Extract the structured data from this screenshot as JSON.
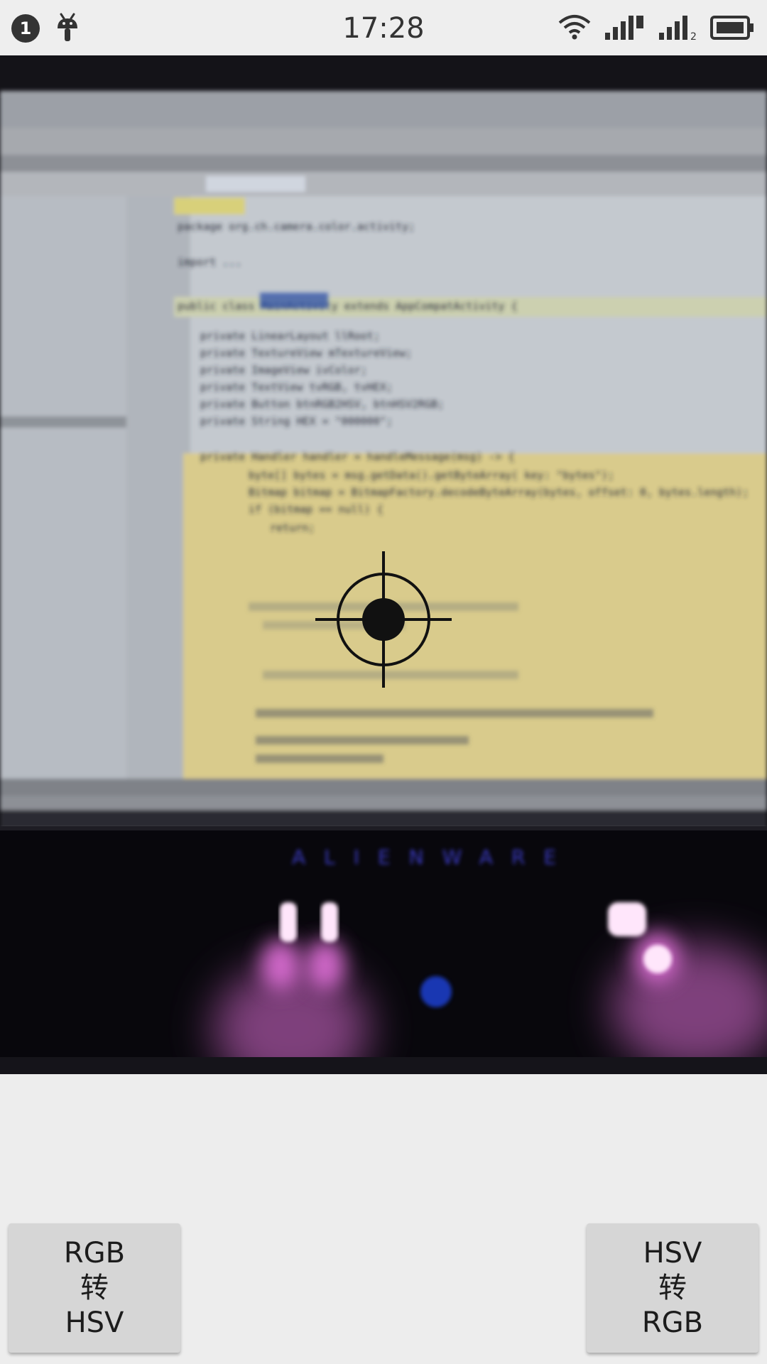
{
  "status_bar": {
    "notification_count": "1",
    "time": "17:28",
    "icons": [
      "notification-badge",
      "android-debug-icon",
      "wifi-icon",
      "signal-sim1-icon",
      "signal-sim2-icon",
      "battery-icon"
    ],
    "sim2_label": "2"
  },
  "camera": {
    "watermark_brand": "ALIENWARE",
    "code_lines": [
      "package org.ch.camera.color.activity;",
      "import ...",
      "public class MainActivity extends AppCompatActivity {",
      "private LinearLayout llRoot;",
      "private TextureView mTextureView;",
      "private ImageView ivColor;",
      "private TextView tvRGB, tvHEX;",
      "private Button btnRGB2HSV, btnHSV2RGB;",
      "private String HEX = \"000000\";",
      "private Handler handler = handleMessage(msg) -> {",
      "byte[] bytes = msg.getData().getByteArray( key: \"bytes\");",
      "Bitmap bitmap = BitmapFactory.decodeByteArray(bytes, offset: 0, bytes.length);",
      "if (bitmap == null) {",
      "return;"
    ],
    "crosshair_icon": "crosshair-icon"
  },
  "buttons": {
    "rgb_to_hsv": {
      "line1": "RGB",
      "line2": "转",
      "line3": "HSV"
    },
    "hsv_to_rgb": {
      "line1": "HSV",
      "line2": "转",
      "line3": "RGB"
    }
  },
  "colors": {
    "background": "#ededed",
    "button": "#d6d6d6",
    "ide_highlight": "#ecdc9a",
    "keyboard_glow": "#e070d8"
  }
}
